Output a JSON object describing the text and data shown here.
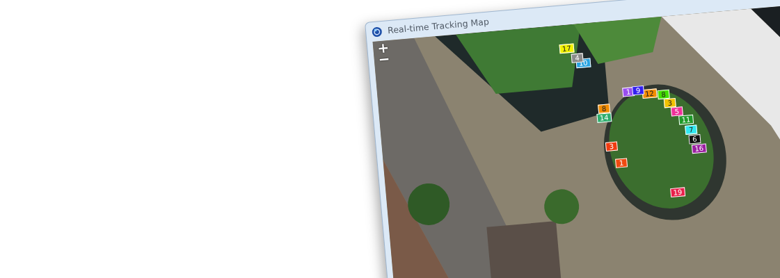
{
  "window": {
    "title": "Real-time Tracking Map"
  },
  "map": {
    "zoom_controls": [
      "+",
      "−"
    ],
    "markers": [
      {
        "label": "17",
        "color": "#f2f200"
      },
      {
        "label": "4",
        "color": "#8a8a8a"
      },
      {
        "label": "10",
        "color": "#29a3e0"
      },
      {
        "label": "9",
        "color": "#3320f0"
      },
      {
        "label": "1",
        "color": "#9a4df0"
      },
      {
        "label": "12",
        "color": "#f28c00"
      },
      {
        "label": "8",
        "color": "#44e000"
      },
      {
        "label": "3",
        "color": "#f2c200"
      },
      {
        "label": "5",
        "color": "#f0309a"
      },
      {
        "label": "11",
        "color": "#1f9a2a"
      },
      {
        "label": "8",
        "color": "#f28c00"
      },
      {
        "label": "14",
        "color": "#2fae6e"
      },
      {
        "label": "3",
        "color": "#f03c10"
      },
      {
        "label": "1",
        "color": "#f04a10"
      },
      {
        "label": "7",
        "color": "#30e8f0"
      },
      {
        "label": "6",
        "color": "#111111"
      },
      {
        "label": "16",
        "color": "#9a1fa0"
      },
      {
        "label": "19",
        "color": "#e8204a"
      }
    ]
  }
}
